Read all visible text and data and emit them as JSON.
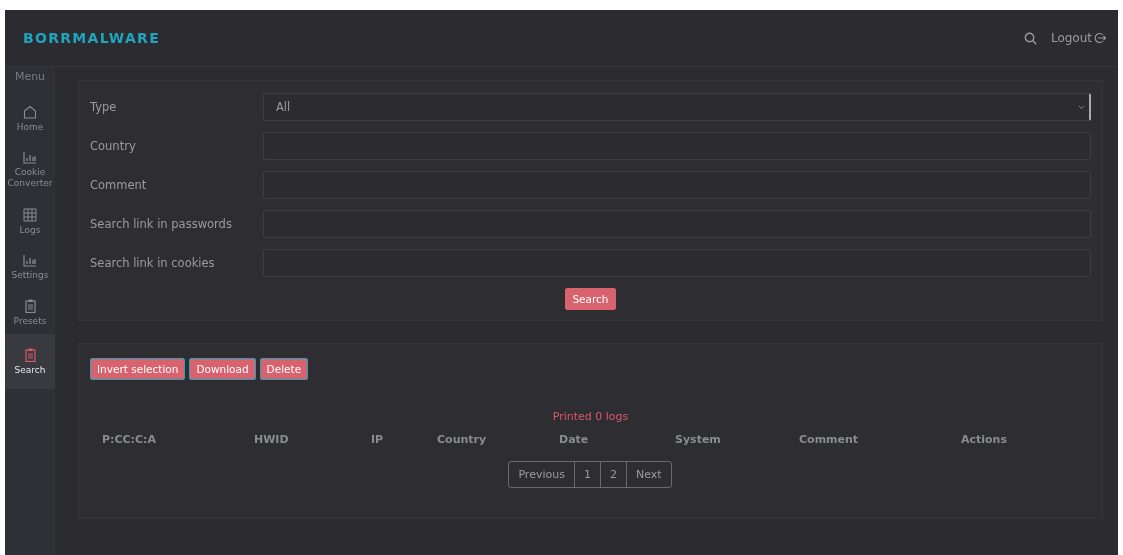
{
  "brand": "BORRMALWARE",
  "header": {
    "logout": "Logout"
  },
  "sidebar": {
    "heading": "Menu",
    "items": [
      {
        "label": "Home",
        "kind": "home",
        "selected": false
      },
      {
        "label": "Cookie Converter",
        "kind": "chart",
        "selected": false
      },
      {
        "label": "Logs",
        "kind": "grid",
        "selected": false
      },
      {
        "label": "Settings",
        "kind": "chart",
        "selected": false
      },
      {
        "label": "Presets",
        "kind": "clipboard",
        "selected": false
      },
      {
        "label": "Search",
        "kind": "clipboard",
        "selected": true
      }
    ]
  },
  "filters": [
    {
      "label": "Type",
      "kind": "select",
      "value": "All"
    },
    {
      "label": "Country",
      "kind": "text"
    },
    {
      "label": "Comment",
      "kind": "text"
    },
    {
      "label": "Search link in passwords",
      "kind": "text"
    },
    {
      "label": "Search link in cookies",
      "kind": "text"
    }
  ],
  "search_button": "Search",
  "actions": [
    "Invert selection",
    "Download",
    "Delete"
  ],
  "status": "Printed 0 logs",
  "table": {
    "columns": [
      "P:CC:C:A",
      "HWID",
      "IP",
      "Country",
      "Date",
      "System",
      "Comment",
      "Actions"
    ]
  },
  "pagination": [
    "Previous",
    "1",
    "2",
    "Next"
  ]
}
